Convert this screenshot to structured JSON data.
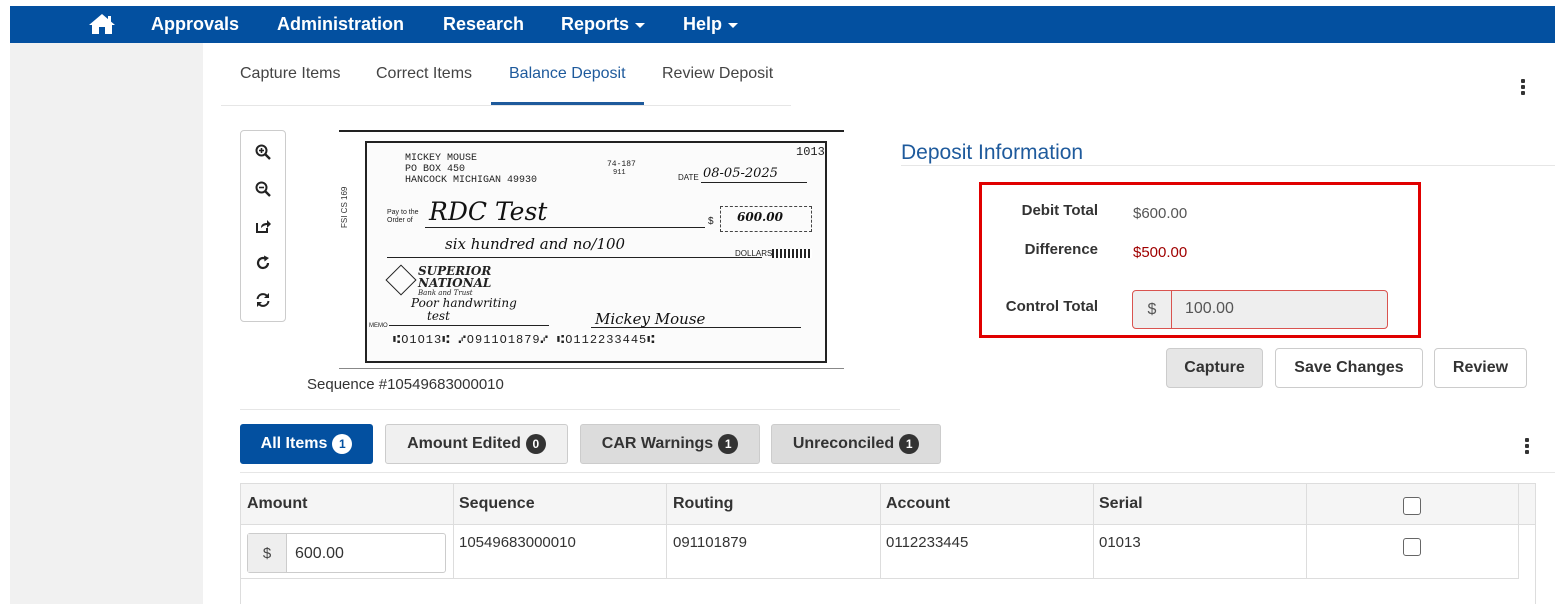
{
  "nav": {
    "home_icon": "home-icon",
    "items": [
      "Approvals",
      "Administration",
      "Research",
      "Reports",
      "Help"
    ]
  },
  "tabs": [
    {
      "label": "Capture Items",
      "active": false
    },
    {
      "label": "Correct Items",
      "active": false
    },
    {
      "label": "Balance Deposit",
      "active": true
    },
    {
      "label": "Review Deposit",
      "active": false
    }
  ],
  "image_tools": [
    "zoom-in-icon",
    "zoom-out-icon",
    "share-icon",
    "rotate-icon",
    "refresh-icon"
  ],
  "check": {
    "payer_name": "MICKEY MOUSE",
    "payer_addr1": "PO BOX 450",
    "payer_addr2": "HANCOCK MICHIGAN 49930",
    "check_number": "1013",
    "fraction": "74-187",
    "fraction_sub": "911",
    "date_label": "DATE",
    "date_value": "08-05-2025",
    "pay_to_label": "Pay to the",
    "order_of_label": "Order of",
    "payee": "RDC Test",
    "amount": "600.00",
    "written_amount": "six hundred and no/100",
    "dollars_label": "DOLLARS",
    "bank_line1": "SUPERIOR",
    "bank_line2": "NATIONAL",
    "bank_line3": "Bank and Trust",
    "memo_handwriting": "Poor handwriting",
    "memo": "test",
    "memo_label": "MEMO",
    "signature": "Mickey Mouse",
    "side_text": "FSI CS 169",
    "micr": "⑆O1O13⑆ ⑇O911O1879⑇ ⑆O112233445⑆"
  },
  "sequence_label": "Sequence #10549683000010",
  "deposit": {
    "title": "Deposit Information",
    "debit_total_label": "Debit Total",
    "debit_total_value": "$600.00",
    "difference_label": "Difference",
    "difference_value": "$500.00",
    "control_total_label": "Control Total",
    "control_currency": "$",
    "control_total_value": "100.00",
    "buttons": {
      "capture": "Capture",
      "save": "Save Changes",
      "review": "Review"
    },
    "colors": {
      "difference": "#a00000",
      "highlight": "#e00000"
    }
  },
  "filters": [
    {
      "label": "All Items",
      "count": "1"
    },
    {
      "label": "Amount Edited",
      "count": "0"
    },
    {
      "label": "CAR Warnings",
      "count": "1"
    },
    {
      "label": "Unreconciled",
      "count": "1"
    }
  ],
  "table": {
    "columns": [
      "Amount",
      "Sequence",
      "Routing",
      "Account",
      "Serial"
    ],
    "rows": [
      {
        "currency": "$",
        "amount": "600.00",
        "sequence": "10549683000010",
        "routing": "091101879",
        "account": "0112233445",
        "serial": "01013"
      }
    ]
  },
  "colors": {
    "primary": "#0350a0",
    "accent": "#1e5a9c"
  }
}
